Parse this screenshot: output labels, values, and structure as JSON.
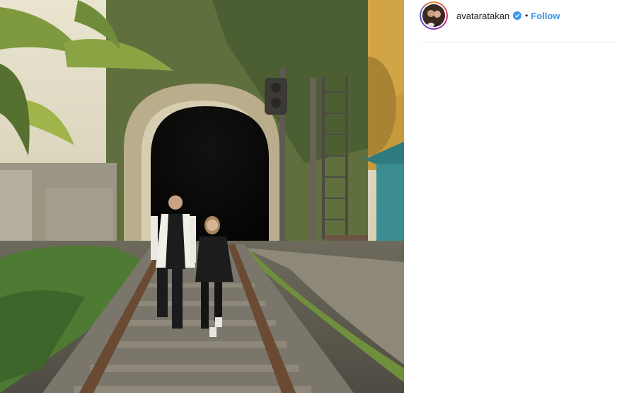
{
  "post": {
    "image_alt": "Couple walking on railway tracks in front of a tunnel",
    "header": {
      "username": "avataratakan",
      "verified": true,
      "separator": "•",
      "follow_label": "Follow"
    }
  },
  "colors": {
    "follow_blue": "#3897f0",
    "text": "#262626",
    "divider": "#efefef"
  },
  "icons": [
    "verified-badge-icon"
  ]
}
